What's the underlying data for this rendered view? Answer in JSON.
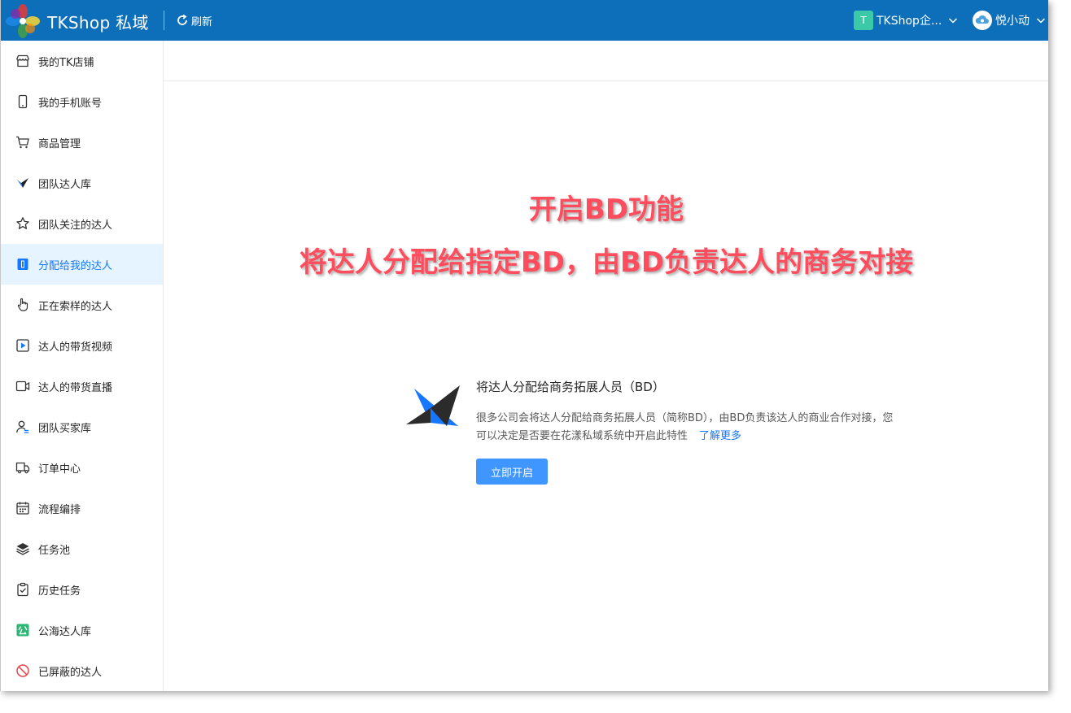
{
  "header": {
    "app_title": "TKShop 私域",
    "refresh_label": "刷新",
    "team_badge": "T",
    "team_name": "TKShop企...",
    "user_name": "悦小动",
    "brand_color": "#0d6fba"
  },
  "sidebar": {
    "items": [
      {
        "label": "我的TK店铺",
        "icon": "store-icon"
      },
      {
        "label": "我的手机账号",
        "icon": "phone-icon"
      },
      {
        "label": "商品管理",
        "icon": "cart-icon"
      },
      {
        "label": "团队达人库",
        "icon": "plane-icon"
      },
      {
        "label": "团队关注的达人",
        "icon": "star-icon"
      },
      {
        "label": "分配给我的达人",
        "icon": "assigned-icon",
        "active": true
      },
      {
        "label": "正在索样的达人",
        "icon": "hand-icon"
      },
      {
        "label": "达人的带货视频",
        "icon": "video-icon"
      },
      {
        "label": "达人的带货直播",
        "icon": "live-icon"
      },
      {
        "label": "团队买家库",
        "icon": "buyer-icon"
      },
      {
        "label": "订单中心",
        "icon": "truck-icon"
      },
      {
        "label": "流程编排",
        "icon": "calendar-icon"
      },
      {
        "label": "任务池",
        "icon": "layers-icon"
      },
      {
        "label": "历史任务",
        "icon": "clipboard-icon"
      },
      {
        "label": "公海达人库",
        "icon": "public-icon"
      },
      {
        "label": "已屏蔽的达人",
        "icon": "block-icon"
      }
    ]
  },
  "main": {
    "overlay_line1": "开启BD功能",
    "overlay_line2": "将达人分配给指定BD，由BD负责达人的商务对接",
    "feature_title": "将达人分配给商务拓展人员（BD）",
    "feature_desc": "很多公司会将达人分配给商务拓展人员（简称BD），由BD负责该达人的商业合作对接，您可以决定是否要在花漾私域系统中开启此特性",
    "learn_more": "了解更多",
    "enable_button": "立即开启"
  }
}
